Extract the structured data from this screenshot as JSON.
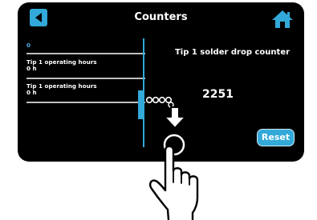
{
  "header": {
    "title": "Counters"
  },
  "sidebar": {
    "items": [
      {
        "label": "",
        "value": "0"
      },
      {
        "label": "Tip 1 operating hours",
        "value": "0 h"
      },
      {
        "label": "Tip 1 operating hours",
        "value": "0 h"
      }
    ]
  },
  "main": {
    "label": "Tip 1 solder drop counter",
    "value": "2251",
    "reset_label": "Reset"
  },
  "colors": {
    "accent": "#32a9d9",
    "background": "#000000",
    "text": "#ffffff"
  },
  "icons": [
    "back-arrow-icon",
    "home-icon",
    "swipe-down-gesture-icon",
    "hand-pointer-icon"
  ]
}
